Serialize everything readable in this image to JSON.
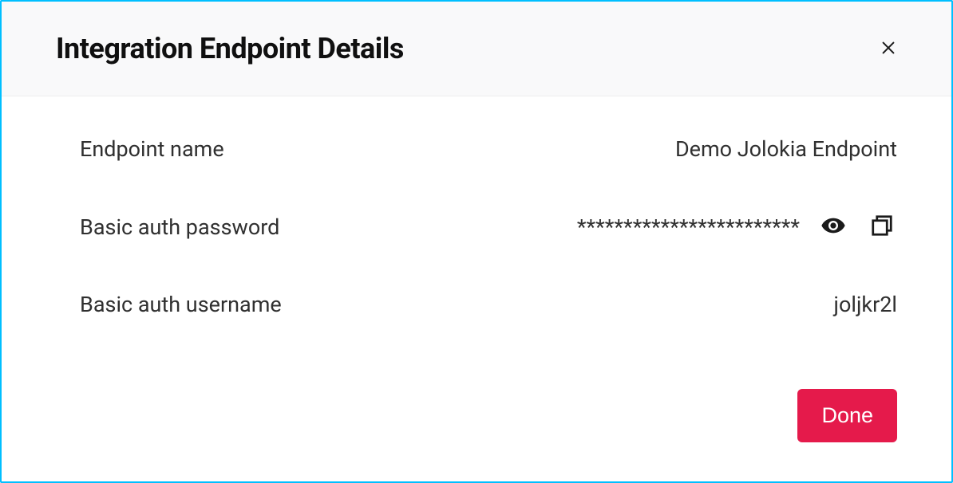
{
  "header": {
    "title": "Integration Endpoint Details"
  },
  "details": {
    "endpoint_name_label": "Endpoint name",
    "endpoint_name_value": "Demo Jolokia Endpoint",
    "password_label": "Basic auth password",
    "password_value": "************************",
    "username_label": "Basic auth username",
    "username_value": "joljkr2l"
  },
  "footer": {
    "done_label": "Done"
  }
}
